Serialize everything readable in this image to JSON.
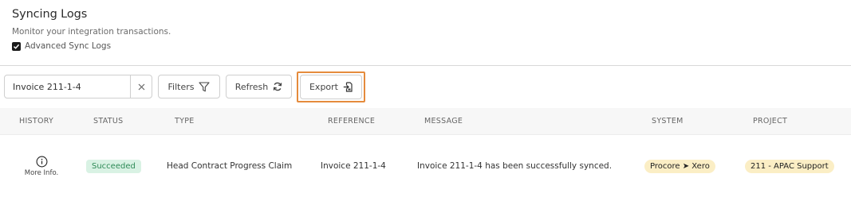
{
  "header": {
    "title": "Syncing Logs",
    "subtitle": "Monitor your integration transactions.",
    "advanced_label": "Advanced Sync Logs",
    "advanced_checked": true
  },
  "toolbar": {
    "search_value": "Invoice 211-1-4",
    "filters_label": "Filters",
    "refresh_label": "Refresh",
    "export_label": "Export",
    "highlight_color": "#e58b3c"
  },
  "table": {
    "columns": [
      "HISTORY",
      "STATUS",
      "TYPE",
      "REFERENCE",
      "MESSAGE",
      "SYSTEM",
      "PROJECT"
    ],
    "rows": [
      {
        "history_label": "More Info.",
        "status": "Succeeded",
        "type": "Head Contract Progress Claim",
        "reference": "Invoice 211-1-4",
        "message": "Invoice 211-1-4 has been successfully synced.",
        "system": "Procore ➤ Xero",
        "project": "211 - APAC Support"
      }
    ]
  },
  "colors": {
    "success_bg": "#d9f2e4",
    "success_text": "#2e8a57",
    "pill_bg": "#fbeec5"
  }
}
